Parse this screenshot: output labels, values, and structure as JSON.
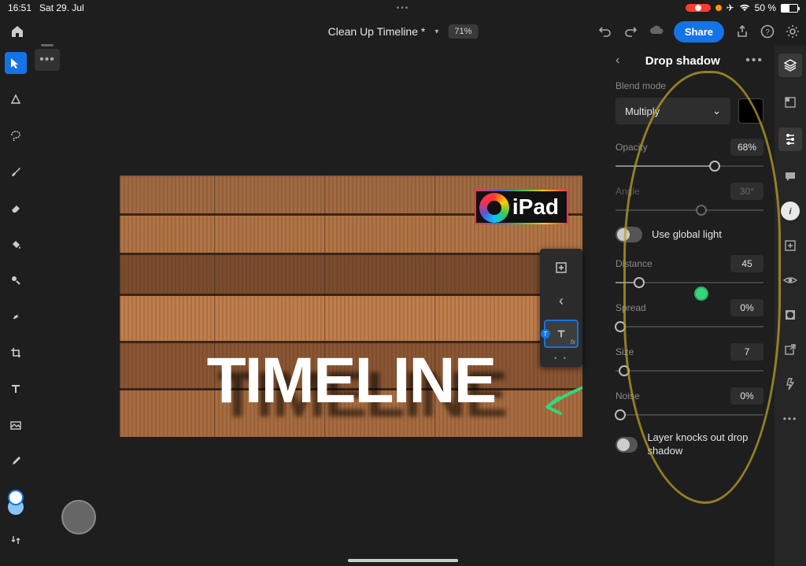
{
  "status": {
    "time": "16:51",
    "date": "Sat 29. Jul",
    "battery": "50 %"
  },
  "header": {
    "title": "Clean Up Timeline *",
    "zoom": "71%",
    "share": "Share"
  },
  "canvas": {
    "badge_text": "iPad",
    "main_text": "TIMELINE"
  },
  "panel": {
    "title": "Drop shadow",
    "blend_mode_label": "Blend mode",
    "blend_mode_value": "Multiply",
    "opacity": {
      "label": "Opacity",
      "value": "68%",
      "pct": 67
    },
    "angle": {
      "label": "Angle",
      "value": "30°",
      "pct": 58
    },
    "global_light": "Use global light",
    "distance": {
      "label": "Distance",
      "value": "45",
      "pct": 16
    },
    "spread": {
      "label": "Spread",
      "value": "0%",
      "pct": 0
    },
    "size": {
      "label": "Size",
      "value": "7",
      "pct": 6
    },
    "noise": {
      "label": "Noise",
      "value": "0%",
      "pct": 0
    },
    "knockout": "Layer knocks out drop shadow"
  },
  "colors": {
    "accent": "#1473e6"
  }
}
